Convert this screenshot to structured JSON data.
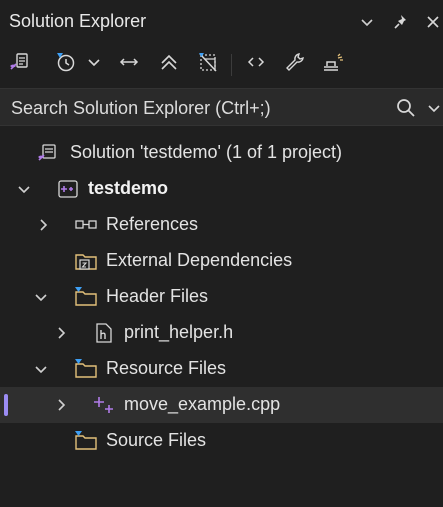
{
  "panel": {
    "title": "Solution Explorer"
  },
  "search": {
    "placeholder": "Search Solution Explorer (Ctrl+;)"
  },
  "tree": {
    "solution": "Solution 'testdemo' (1 of 1 project)",
    "project": "testdemo",
    "references": "References",
    "external_deps": "External Dependencies",
    "header_files": "Header Files",
    "header_file_1": "print_helper.h",
    "resource_files": "Resource Files",
    "resource_file_1": "move_example.cpp",
    "source_files": "Source Files"
  },
  "colors": {
    "background": "#1f1f1f",
    "accent_purple": "#9b8cf3",
    "folder_outline": "#e3c07a",
    "blue_marker": "#3ea0f5"
  }
}
